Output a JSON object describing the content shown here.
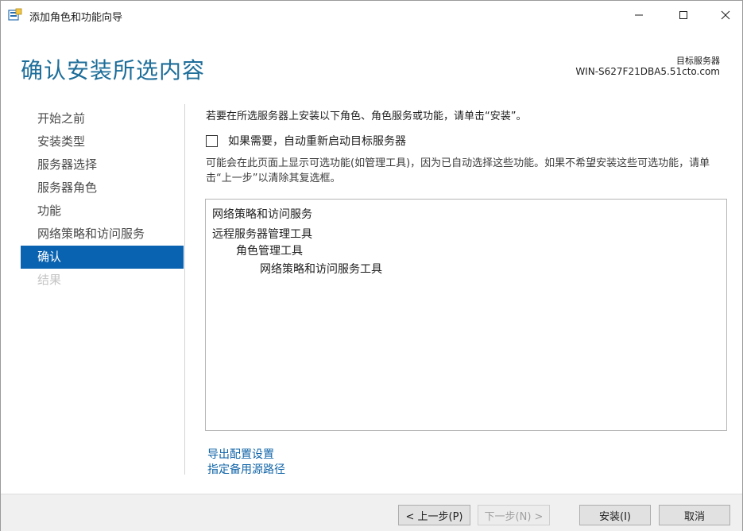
{
  "window": {
    "title": "添加角色和功能向导",
    "minimize_icon": "minimize-icon",
    "maximize_icon": "maximize-icon",
    "close_icon": "close-icon"
  },
  "header": {
    "page_title": "确认安装所选内容",
    "target_label": "目标服务器",
    "target_server": "WIN-S627F21DBA5.51cto.com"
  },
  "nav": {
    "items": [
      {
        "label": "开始之前",
        "state": "normal"
      },
      {
        "label": "安装类型",
        "state": "normal"
      },
      {
        "label": "服务器选择",
        "state": "normal"
      },
      {
        "label": "服务器角色",
        "state": "normal"
      },
      {
        "label": "功能",
        "state": "normal"
      },
      {
        "label": "网络策略和访问服务",
        "state": "normal"
      },
      {
        "label": "确认",
        "state": "active"
      },
      {
        "label": "结果",
        "state": "disabled"
      }
    ]
  },
  "content": {
    "description": "若要在所选服务器上安装以下角色、角色服务或功能，请单击“安装”。",
    "restart_label": "如果需要，自动重新启动目标服务器",
    "restart_checked": false,
    "note": "可能会在此页面上显示可选功能(如管理工具)，因为已自动选择这些功能。如果不希望安装这些可选功能，请单击“上一步”以清除其复选框。",
    "features": [
      "网络策略和访问服务",
      "远程服务器管理工具",
      "角色管理工具",
      "网络策略和访问服务工具"
    ],
    "export_link": "导出配置设置",
    "source_link": "指定备用源路径"
  },
  "footer": {
    "prev_label": "< 上一步(P)",
    "next_label": "下一步(N) >",
    "install_label": "安装(I)",
    "cancel_label": "取消"
  },
  "colors": {
    "accent": "#0a63b0",
    "title": "#1e6e9a",
    "link": "#1064a8"
  }
}
